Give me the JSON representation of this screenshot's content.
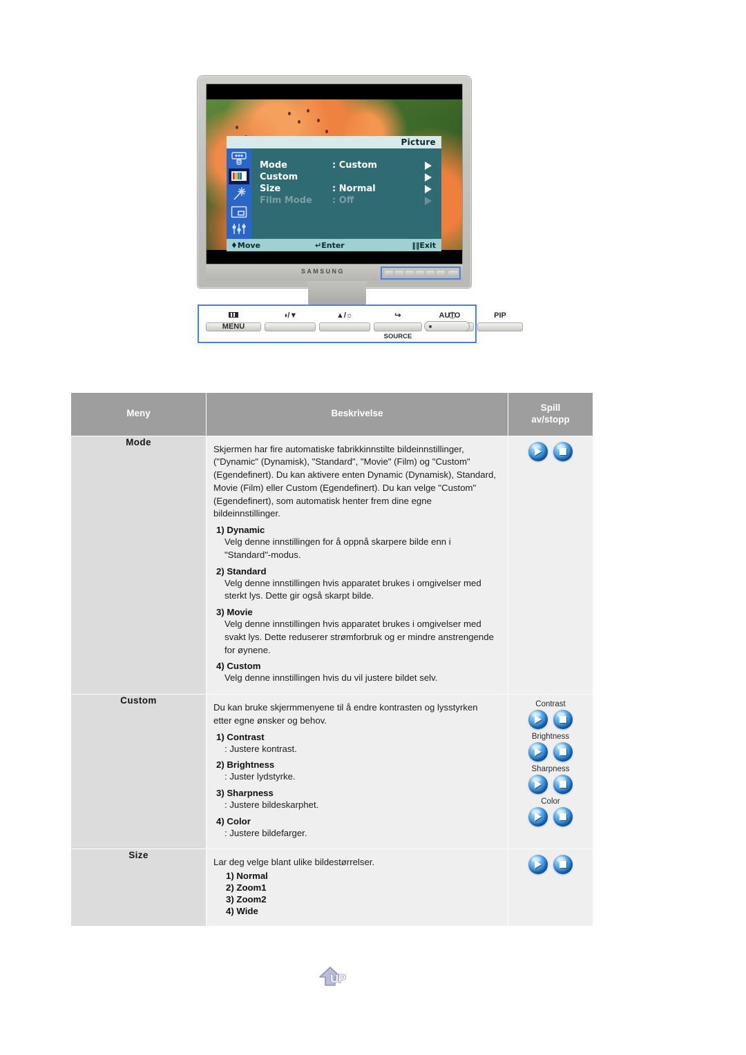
{
  "monitor": {
    "brand_logo": "SAMSUNG",
    "osd": {
      "title": "Picture",
      "sidebar_icons": [
        "input-source-icon",
        "picture-color-bars-icon",
        "magic-wand-icon",
        "pip-icon",
        "setup-sliders-icon"
      ],
      "selected_icon_index": 1,
      "rows": [
        {
          "label": "Mode",
          "value": ": Custom",
          "dimmed": false
        },
        {
          "label": "Custom",
          "value": "",
          "dimmed": false
        },
        {
          "label": "Size",
          "value": ": Normal",
          "dimmed": false
        },
        {
          "label": "Film Mode",
          "value": ": Off",
          "dimmed": true
        }
      ],
      "footer": {
        "move": "Move",
        "enter": "Enter",
        "exit": "Exit"
      }
    }
  },
  "button_panel": {
    "buttons": [
      {
        "caption": "MENU",
        "icon": "menu-bars-icon",
        "sub": ""
      },
      {
        "caption": "/▼",
        "icon": "contrast-down-icon",
        "sub": ""
      },
      {
        "caption": "▲/",
        "icon": "brightness-up-icon",
        "sub": ""
      },
      {
        "caption": "",
        "icon": "source-enter-icon",
        "sub": "SOURCE"
      },
      {
        "caption": "AUTO",
        "icon": "auto-icon",
        "sub": ""
      },
      {
        "caption": "PIP",
        "icon": "pip-icon",
        "sub": ""
      }
    ],
    "power": {
      "icon": "power-icon",
      "label": ""
    }
  },
  "table": {
    "headers": {
      "menu": "Meny",
      "description": "Beskrivelse",
      "play": "Spill\nav/stopp"
    },
    "header_menu": "Meny",
    "header_description": "Beskrivelse",
    "header_play_line1": "Spill",
    "header_play_line2": "av/stopp",
    "rows": [
      {
        "menu": "Mode",
        "intro": "Skjermen har fire automatiske fabrikkinnstilte bildeinnstillinger, (\"Dynamic\" (Dynamisk), \"Standard\", \"Movie\" (Film) og \"Custom\" (Egendefinert). Du kan aktivere enten Dynamic (Dynamisk), Standard, Movie (Film) eller Custom (Egendefinert). Du kan velge \"Custom\" (Egendefinert), som automatisk henter frem dine egne bildeinnstillinger.",
        "items": [
          {
            "num": "1) Dynamic",
            "text": "Velg denne innstillingen for å oppnå skarpere bilde enn i \"Standard\"-modus."
          },
          {
            "num": "2) Standard",
            "text": "Velg denne innstillingen hvis apparatet brukes i omgivelser med sterkt lys. Dette gir også skarpt bilde."
          },
          {
            "num": "3) Movie",
            "text": "Velg denne innstillingen hvis apparatet brukes i omgivelser med svakt lys. Dette reduserer strømforbruk og er mindre anstrengende for øynene."
          },
          {
            "num": "4) Custom",
            "text": "Velg denne innstillingen hvis du vil justere bildet selv."
          }
        ],
        "play_groups": [
          {
            "label": "",
            "play": "play-icon",
            "stop": "stop-icon"
          }
        ]
      },
      {
        "menu": "Custom",
        "intro": "Du kan bruke skjermmenyene til å endre kontrasten og lysstyrken etter egne ønsker og behov.",
        "items": [
          {
            "num": "1) Contrast",
            "text": ": Justere kontrast."
          },
          {
            "num": "2) Brightness",
            "text": ": Juster lydstyrke."
          },
          {
            "num": "3) Sharpness",
            "text": ": Justere bildeskarphet."
          },
          {
            "num": "4) Color",
            "text": ": Justere bildefarger."
          }
        ],
        "play_groups": [
          {
            "label": "Contrast",
            "play": "play-icon",
            "stop": "stop-icon"
          },
          {
            "label": "Brightness",
            "play": "play-icon",
            "stop": "stop-icon"
          },
          {
            "label": "Sharpness",
            "play": "play-icon",
            "stop": "stop-icon"
          },
          {
            "label": "Color",
            "play": "play-icon",
            "stop": "stop-icon"
          }
        ]
      },
      {
        "menu": "Size",
        "intro": "Lar deg velge blant ulike bildestørrelser.",
        "size_items": [
          "1) Normal",
          "2) Zoom1",
          "3) Zoom2",
          "4) Wide"
        ],
        "play_groups": [
          {
            "label": "",
            "play": "play-icon",
            "stop": "stop-icon"
          }
        ]
      }
    ]
  },
  "footer": {
    "up_label": "UP",
    "up_icon": "up-arrow-icon"
  },
  "colors": {
    "header_bg": "#9e9e9e",
    "menu_cell_bg": "#dcdcdc",
    "desc_cell_bg": "#efefef",
    "highlight_box": "#4a7fe0",
    "osd_bg": "#2f6b72",
    "osd_sidebar": "#2a66c8",
    "sphere_blue": "#2d8ada"
  }
}
